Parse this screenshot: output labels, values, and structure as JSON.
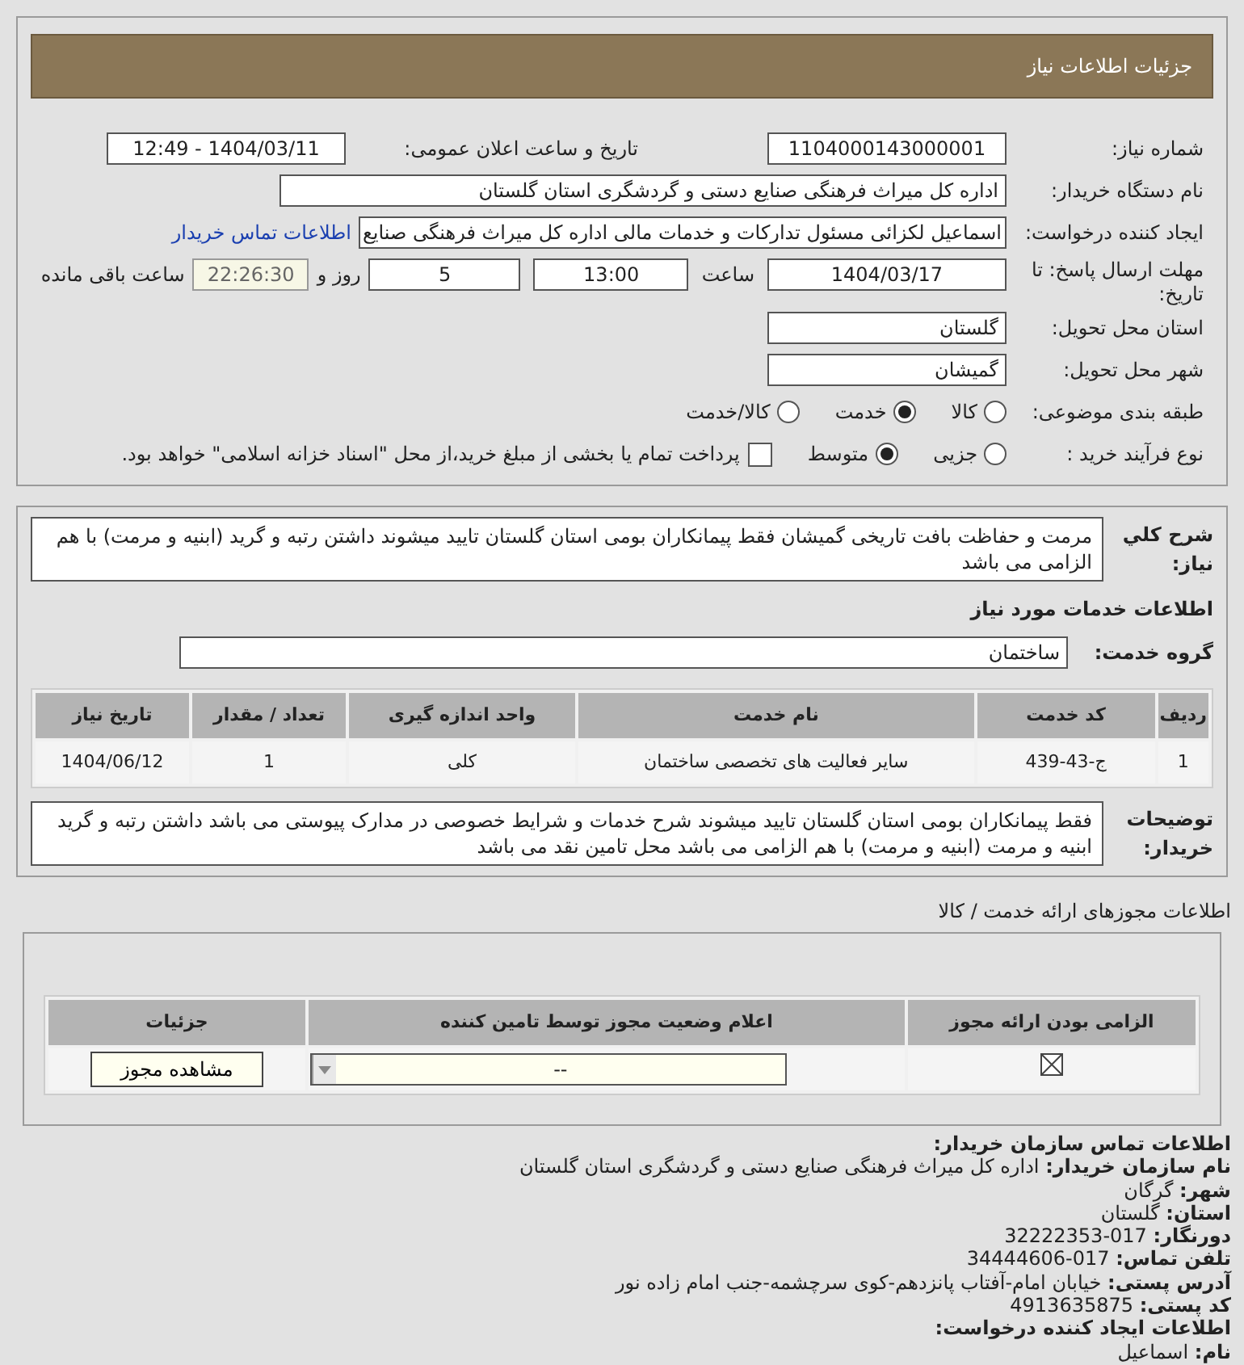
{
  "header": {
    "title": "جزئیات اطلاعات نیاز"
  },
  "need_number": {
    "label": "شماره نیاز:",
    "value": "1104000143000001"
  },
  "announce": {
    "label": "تاریخ و ساعت اعلان عمومی:",
    "value": "1404/03/11 - 12:49"
  },
  "buyer": {
    "label": "نام دستگاه خریدار:",
    "value": "اداره کل میراث فرهنگی  صنایع دستی و گردشگری استان گلستان"
  },
  "creator": {
    "label": "ایجاد کننده درخواست:",
    "value": "اسماعیل لکزائی مسئول تدارکات و خدمات مالی اداره کل میراث فرهنگی  صنایع",
    "link": "اطلاعات تماس خریدار"
  },
  "deadline": {
    "label": "مهلت ارسال پاسخ: تا تاریخ:",
    "date": "1404/03/17",
    "time_label": "ساعت",
    "time": "13:00",
    "days": "5",
    "days_label": "روز و",
    "remaining": "22:26:30",
    "remaining_label": "ساعت باقی مانده"
  },
  "province": {
    "label": "استان محل تحویل:",
    "value": "گلستان"
  },
  "city": {
    "label": "شهر محل تحویل:",
    "value": "گمیشان"
  },
  "category": {
    "label": "طبقه بندی موضوعی:",
    "options": [
      {
        "label": "کالا",
        "selected": false
      },
      {
        "label": "خدمت",
        "selected": true
      },
      {
        "label": "کالا/خدمت",
        "selected": false
      }
    ]
  },
  "purchase_type": {
    "label": "نوع فرآیند خرید :",
    "options": [
      {
        "label": "جزیی",
        "selected": false
      },
      {
        "label": "متوسط",
        "selected": true
      }
    ],
    "payment": {
      "label": "پرداخت تمام یا بخشی از مبلغ خرید،از محل \"اسناد خزانه اسلامی\" خواهد بود.",
      "checked": false
    }
  },
  "description": {
    "label": "شرح کلي نياز:",
    "value": "مرمت و حفاظت بافت تاریخی گمیشان فقط پیمانکاران بومی استان گلستان تایید میشوند داشتن رتبه و گرید (ابنیه و مرمت) با هم الزامی می باشد"
  },
  "services_title": "اطلاعات خدمات مورد نیاز",
  "service_group": {
    "label": "گروه خدمت:",
    "value": "ساختمان"
  },
  "services_table": {
    "columns": [
      "ردیف",
      "کد خدمت",
      "نام خدمت",
      "واحد اندازه گیری",
      "تعداد / مقدار",
      "تاریخ نیاز"
    ],
    "rows": [
      [
        "1",
        "ج-43-439",
        "سایر فعالیت های تخصصی ساختمان",
        "کلی",
        "1",
        "1404/06/12"
      ]
    ]
  },
  "buyer_notes": {
    "label": "توضیحات خریدار:",
    "value": "فقط پیمانکاران بومی استان گلستان تایید میشوند شرح خدمات و شرایط خصوصی در مدارک پیوستی می باشد داشتن رتبه و گرید ابنیه و مرمت (ابنیه و مرمت) با هم الزامی می باشد محل تامین نقد می باشد"
  },
  "permits_title": "اطلاعات مجوزهای ارائه خدمت / کالا",
  "permits_table": {
    "columns": [
      "الزامی بودن ارائه مجوز",
      "اعلام وضعیت مجوز توسط تامین کننده",
      "جزئیات"
    ],
    "rows": [
      {
        "required": true,
        "status": "--",
        "button": "مشاهده مجوز"
      }
    ]
  },
  "contact": {
    "title": "اطلاعات تماس سازمان خریدار:",
    "lines": [
      {
        "label": "نام سازمان خریدار:",
        "value": "اداره کل میراث فرهنگی صنایع دستی و گردشگری استان گلستان"
      },
      {
        "label": "شهر:",
        "value": "گرگان"
      },
      {
        "label": "استان:",
        "value": "گلستان"
      },
      {
        "label": "دورنگار:",
        "value": "017-32222353"
      },
      {
        "label": "تلفن تماس:",
        "value": "017-34444606"
      },
      {
        "label": "آدرس پستی:",
        "value": "خیابان امام-آفتاب پانزدهم-کوی سرچشمه-جنب امام زاده نور"
      },
      {
        "label": "کد پستی:",
        "value": "4913635875"
      }
    ]
  },
  "creator_info": {
    "title": "اطلاعات ایجاد کننده درخواست:",
    "lines": [
      {
        "label": "نام:",
        "value": "اسماعیل"
      }
    ]
  }
}
